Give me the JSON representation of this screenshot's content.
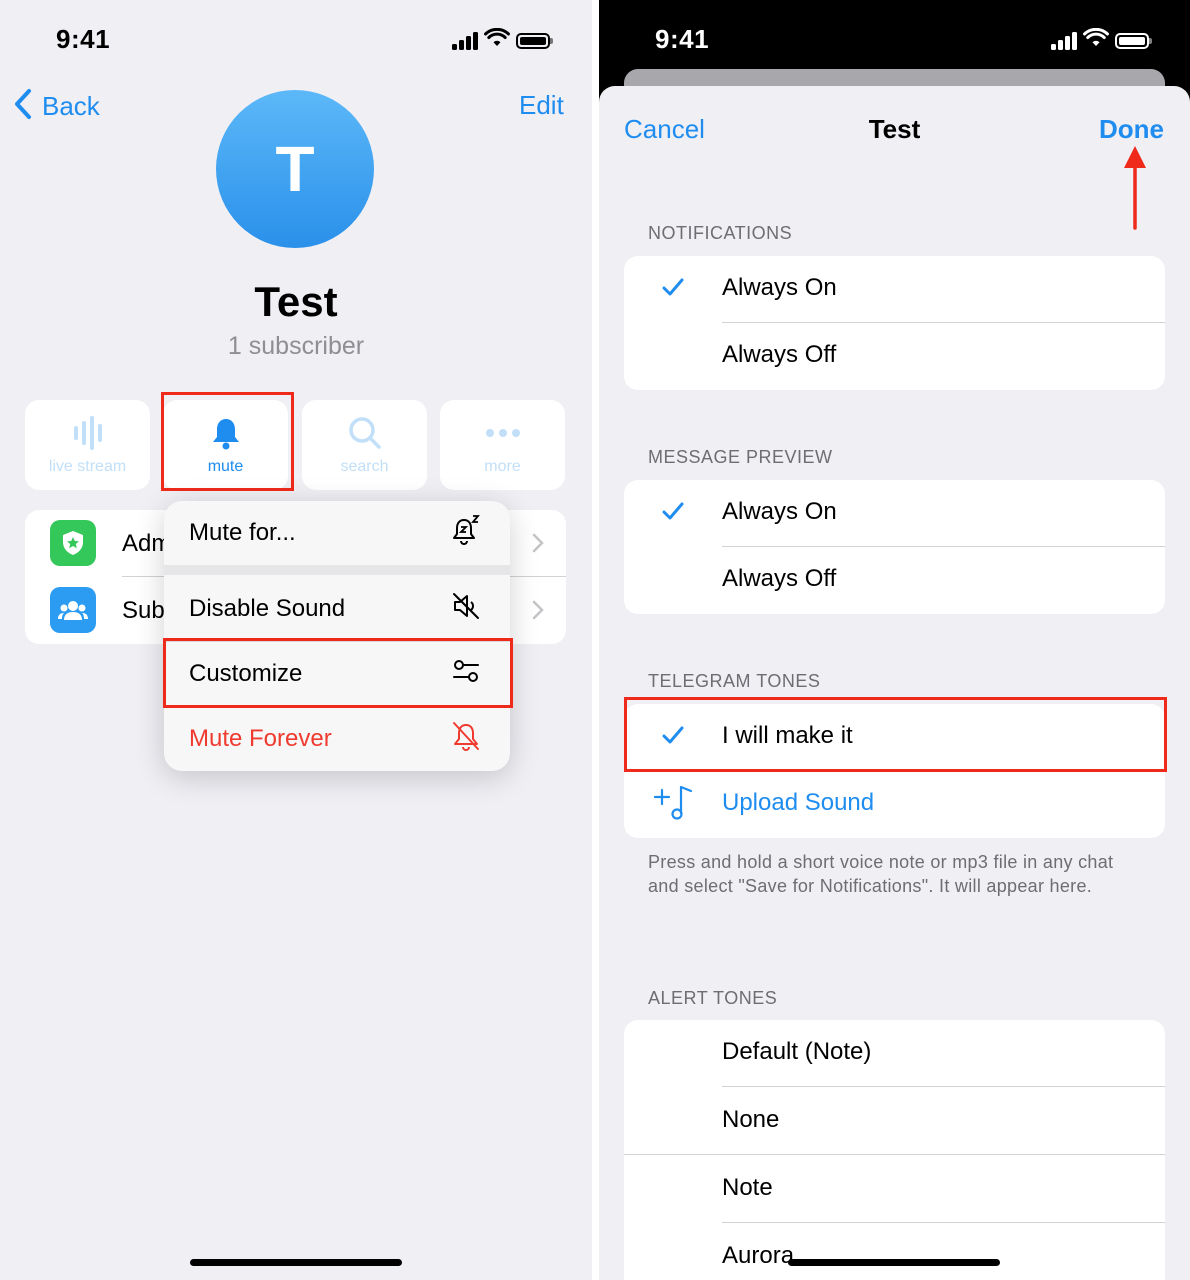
{
  "left_screen": {
    "status_bar": {
      "time": "9:41"
    },
    "nav": {
      "back_label": "Back",
      "edit_label": "Edit"
    },
    "profile": {
      "avatar_letter": "T",
      "name": "Test",
      "subscribers": "1 subscriber",
      "avatar_color": "#3aa2f2"
    },
    "actions": [
      {
        "label": "live stream",
        "icon": "waveform-icon"
      },
      {
        "label": "mute",
        "icon": "bell-icon"
      },
      {
        "label": "search",
        "icon": "search-icon"
      },
      {
        "label": "more",
        "icon": "ellipsis-icon"
      }
    ],
    "info_rows": [
      {
        "label": "Adm",
        "icon": "admin-shield-icon",
        "icon_color": "#34c759"
      },
      {
        "label": "Sub",
        "icon": "subscribers-icon",
        "icon_color": "#2b9cf2"
      }
    ],
    "menu": {
      "items": [
        {
          "label": "Mute for...",
          "icon": "bell-zzz-icon"
        },
        {
          "label": "Disable Sound",
          "icon": "speaker-slash-icon"
        },
        {
          "label": "Customize",
          "icon": "sliders-icon"
        },
        {
          "label": "Mute Forever",
          "icon": "bell-slash-icon",
          "style": "destructive"
        }
      ]
    }
  },
  "right_screen": {
    "status_bar": {
      "time": "9:41"
    },
    "nav": {
      "cancel_label": "Cancel",
      "title": "Test",
      "done_label": "Done"
    },
    "sections": {
      "notifications": {
        "header": "NOTIFICATIONS",
        "options": [
          "Always On",
          "Always Off"
        ],
        "selected": "Always On"
      },
      "message_preview": {
        "header": "MESSAGE PREVIEW",
        "options": [
          "Always On",
          "Always Off"
        ],
        "selected": "Always On"
      },
      "telegram_tones": {
        "header": "TELEGRAM TONES",
        "selected_tone": "I will make it",
        "upload_label": "Upload Sound",
        "footnote": "Press and hold a short voice note or mp3 file in any chat and select \"Save for Notifications\". It will appear here."
      },
      "alert_tones": {
        "header": "ALERT TONES",
        "options": [
          "Default (Note)",
          "None",
          "Note",
          "Aurora"
        ]
      }
    }
  },
  "colors": {
    "accent": "#1f8df0",
    "destructive": "#ef3b2f",
    "highlight": "#ef2a1b",
    "background": "#efeff4"
  }
}
